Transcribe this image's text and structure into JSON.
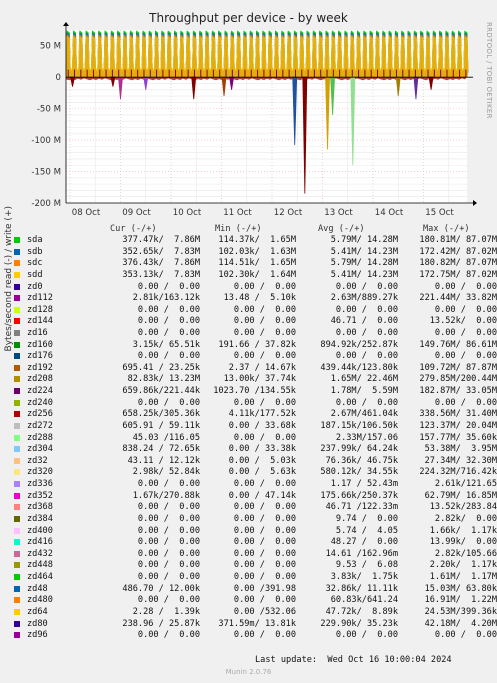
{
  "title": "Throughput per device - by week",
  "side_label": "RRDTOOL / TOBI OETIKER",
  "footer": "Last update:  Wed Oct 16 10:00:04 2024",
  "munin": "Munin 2.0.76",
  "chart_data": {
    "type": "area",
    "title": "Throughput per device - by week",
    "ylabel": "Bytes/second read (-) / write (+)",
    "ylim": [
      -200,
      75
    ],
    "yticks": [
      {
        "value": 50,
        "label": "50 M"
      },
      {
        "value": 0,
        "label": "0"
      },
      {
        "value": -50,
        "label": "-50 M"
      },
      {
        "value": -100,
        "label": "-100 M"
      },
      {
        "value": -150,
        "label": "-150 M"
      },
      {
        "value": -200,
        "label": "-200 M"
      }
    ],
    "xticks": [
      "08 Oct",
      "09 Oct",
      "10 Oct",
      "11 Oct",
      "12 Oct",
      "13 Oct",
      "14 Oct",
      "15 Oct"
    ],
    "grid": true,
    "baseline_write": 78,
    "write_spikes_per_day": 8,
    "read_spikes": [
      {
        "day": 0.05,
        "depth": -15,
        "color": "#800000"
      },
      {
        "day": 0.85,
        "depth": -15,
        "color": "#800000"
      },
      {
        "day": 1.0,
        "depth": -35,
        "color": "#b03090"
      },
      {
        "day": 1.5,
        "depth": -20,
        "color": "#9040d0"
      },
      {
        "day": 2.45,
        "depth": -35,
        "color": "#800000"
      },
      {
        "day": 3.05,
        "depth": -30,
        "color": "#a04000"
      },
      {
        "day": 3.2,
        "depth": -20,
        "color": "#800080"
      },
      {
        "day": 4.45,
        "depth": -108,
        "color": "#2050a0"
      },
      {
        "day": 4.65,
        "depth": -185,
        "color": "#800000"
      },
      {
        "day": 5.1,
        "depth": -115,
        "color": "#d4a000"
      },
      {
        "day": 5.2,
        "depth": -60,
        "color": "#50c050"
      },
      {
        "day": 5.6,
        "depth": -140,
        "color": "#90e090"
      },
      {
        "day": 6.5,
        "depth": -30,
        "color": "#a08000"
      },
      {
        "day": 6.85,
        "depth": -35,
        "color": "#6030a0"
      },
      {
        "day": 7.15,
        "depth": -20,
        "color": "#800000"
      }
    ],
    "columns": {
      "cur": "Cur (-/+)",
      "min": "Min (-/+)",
      "avg": "Avg (-/+)",
      "max": "Max (-/+)"
    },
    "series": [
      {
        "name": "sda",
        "color": "#00cc00",
        "cur": "377.47k/  7.86M",
        "min": "114.37k/  1.65M",
        "avg": "5.79M/ 14.28M",
        "max": "180.81M/ 87.07M"
      },
      {
        "name": "sdb",
        "color": "#0066b3",
        "cur": "352.65k/  7.83M",
        "min": "102.03k/  1.63M",
        "avg": "5.41M/ 14.23M",
        "max": "172.42M/ 87.02M"
      },
      {
        "name": "sdc",
        "color": "#ff8000",
        "cur": "376.43k/  7.86M",
        "min": "114.51k/  1.65M",
        "avg": "5.79M/ 14.28M",
        "max": "180.82M/ 87.07M"
      },
      {
        "name": "sdd",
        "color": "#ffcc00",
        "cur": "353.13k/  7.83M",
        "min": "102.30k/  1.64M",
        "avg": "5.41M/ 14.23M",
        "max": "172.75M/ 87.02M"
      },
      {
        "name": "zd0",
        "color": "#330099",
        "cur": "0.00 /  0.00",
        "min": "0.00 /  0.00",
        "avg": "0.00 /  0.00",
        "max": "0.00 /  0.00"
      },
      {
        "name": "zd112",
        "color": "#990099",
        "cur": "2.81k/163.12k",
        "min": "13.48 /  5.10k",
        "avg": "2.63M/889.27k",
        "max": "221.44M/ 33.82M"
      },
      {
        "name": "zd128",
        "color": "#ccff00",
        "cur": "0.00 /  0.00",
        "min": "0.00 /  0.00",
        "avg": "0.00 /  0.00",
        "max": "0.00 /  0.00"
      },
      {
        "name": "zd144",
        "color": "#ff0000",
        "cur": "0.00 /  0.00",
        "min": "0.00 /  0.00",
        "avg": "46.71 /  0.00",
        "max": "13.52k/  0.00"
      },
      {
        "name": "zd16",
        "color": "#808080",
        "cur": "0.00 /  0.00",
        "min": "0.00 /  0.00",
        "avg": "0.00 /  0.00",
        "max": "0.00 /  0.00"
      },
      {
        "name": "zd160",
        "color": "#008f00",
        "cur": "3.15k/ 65.51k",
        "min": "191.66 / 37.82k",
        "avg": "894.92k/252.87k",
        "max": "149.76M/ 86.61M"
      },
      {
        "name": "zd176",
        "color": "#00487d",
        "cur": "0.00 /  0.00",
        "min": "0.00 /  0.00",
        "avg": "0.00 /  0.00",
        "max": "0.00 /  0.00"
      },
      {
        "name": "zd192",
        "color": "#b35a00",
        "cur": "695.41 / 23.25k",
        "min": "2.37 / 14.67k",
        "avg": "439.44k/123.80k",
        "max": "109.72M/ 87.87M"
      },
      {
        "name": "zd208",
        "color": "#b38f00",
        "cur": "82.83k/ 13.23M",
        "min": "13.00k/ 37.74k",
        "avg": "1.65M/ 22.46M",
        "max": "279.85M/200.44M"
      },
      {
        "name": "zd224",
        "color": "#6b006b",
        "cur": "659.86k/221.44k",
        "min": "1023.70 /134.55k",
        "avg": "1.78M/  5.59M",
        "max": "182.87M/ 33.05M"
      },
      {
        "name": "zd240",
        "color": "#8fb300",
        "cur": "0.00 /  0.00",
        "min": "0.00 /  0.00",
        "avg": "0.00 /  0.00",
        "max": "0.00 /  0.00"
      },
      {
        "name": "zd256",
        "color": "#b30000",
        "cur": "658.25k/305.36k",
        "min": "4.11k/177.52k",
        "avg": "2.67M/461.04k",
        "max": "338.56M/ 31.40M"
      },
      {
        "name": "zd272",
        "color": "#bebebe",
        "cur": "605.91 / 59.11k",
        "min": "0.00 / 33.68k",
        "avg": "187.15k/106.50k",
        "max": "123.37M/ 20.04M"
      },
      {
        "name": "zd288",
        "color": "#80ff80",
        "cur": "45.03 /116.05",
        "min": "0.00 /  0.00",
        "avg": "2.33M/157.06",
        "max": "157.77M/ 35.60k"
      },
      {
        "name": "zd304",
        "color": "#80c9ff",
        "cur": "838.24 / 72.65k",
        "min": "0.00 / 33.38k",
        "avg": "237.99k/ 64.24k",
        "max": "53.38M/  3.95M"
      },
      {
        "name": "zd32",
        "color": "#ffc080",
        "cur": "43.11 / 12.12k",
        "min": "0.00 /  5.03k",
        "avg": "76.36k/ 46.75k",
        "max": "27.34M/ 32.30M"
      },
      {
        "name": "zd320",
        "color": "#ffe680",
        "cur": "2.98k/ 52.84k",
        "min": "0.00 /  5.63k",
        "avg": "580.12k/ 34.55k",
        "max": "224.32M/716.42k"
      },
      {
        "name": "zd336",
        "color": "#aa80ff",
        "cur": "0.00 /  0.00",
        "min": "0.00 /  0.00",
        "avg": "1.17 / 52.43m",
        "max": "2.61k/121.65"
      },
      {
        "name": "zd352",
        "color": "#ee00cc",
        "cur": "1.67k/270.88k",
        "min": "0.00 / 47.14k",
        "avg": "175.66k/250.37k",
        "max": "62.79M/ 16.85M"
      },
      {
        "name": "zd368",
        "color": "#ff8080",
        "cur": "0.00 /  0.00",
        "min": "0.00 /  0.00",
        "avg": "46.71 /122.33m",
        "max": "13.52k/283.84"
      },
      {
        "name": "zd384",
        "color": "#666600",
        "cur": "0.00 /  0.00",
        "min": "0.00 /  0.00",
        "avg": "9.74 /  0.00",
        "max": "2.82k/  0.00"
      },
      {
        "name": "zd400",
        "color": "#ffbfff",
        "cur": "0.00 /  0.00",
        "min": "0.00 /  0.00",
        "avg": "5.74 /  4.05",
        "max": "1.66k/  1.17k"
      },
      {
        "name": "zd416",
        "color": "#00ffcc",
        "cur": "0.00 /  0.00",
        "min": "0.00 /  0.00",
        "avg": "48.27 /  0.00",
        "max": "13.99k/  0.00"
      },
      {
        "name": "zd432",
        "color": "#cc6699",
        "cur": "0.00 /  0.00",
        "min": "0.00 /  0.00",
        "avg": "14.61 /162.96m",
        "max": "2.82k/105.66"
      },
      {
        "name": "zd448",
        "color": "#999900",
        "cur": "0.00 /  0.00",
        "min": "0.00 /  0.00",
        "avg": "9.53 /  6.08",
        "max": "2.20k/  1.17k"
      },
      {
        "name": "zd464",
        "color": "#00cc00",
        "cur": "0.00 /  0.00",
        "min": "0.00 /  0.00",
        "avg": "3.83k/  1.75k",
        "max": "1.61M/  1.17M"
      },
      {
        "name": "zd48",
        "color": "#0066b3",
        "cur": "486.70 / 12.00k",
        "min": "0.00 /391.98",
        "avg": "32.86k/ 11.11k",
        "max": "15.03M/ 63.80k"
      },
      {
        "name": "zd480",
        "color": "#ff8000",
        "cur": "0.00 /  0.00",
        "min": "0.00 /  0.00",
        "avg": "60.83k/641.24",
        "max": "16.91M/  1.22M"
      },
      {
        "name": "zd64",
        "color": "#ffcc00",
        "cur": "2.28 /  1.39k",
        "min": "0.00 /532.06",
        "avg": "47.72k/  8.89k",
        "max": "24.53M/399.36k"
      },
      {
        "name": "zd80",
        "color": "#330099",
        "cur": "238.96 / 25.87k",
        "min": "371.59m/ 13.81k",
        "avg": "229.90k/ 35.23k",
        "max": "42.18M/  4.20M"
      },
      {
        "name": "zd96",
        "color": "#990099",
        "cur": "0.00 /  0.00",
        "min": "0.00 /  0.00",
        "avg": "0.00 /  0.00",
        "max": "0.00 /  0.00"
      }
    ]
  }
}
